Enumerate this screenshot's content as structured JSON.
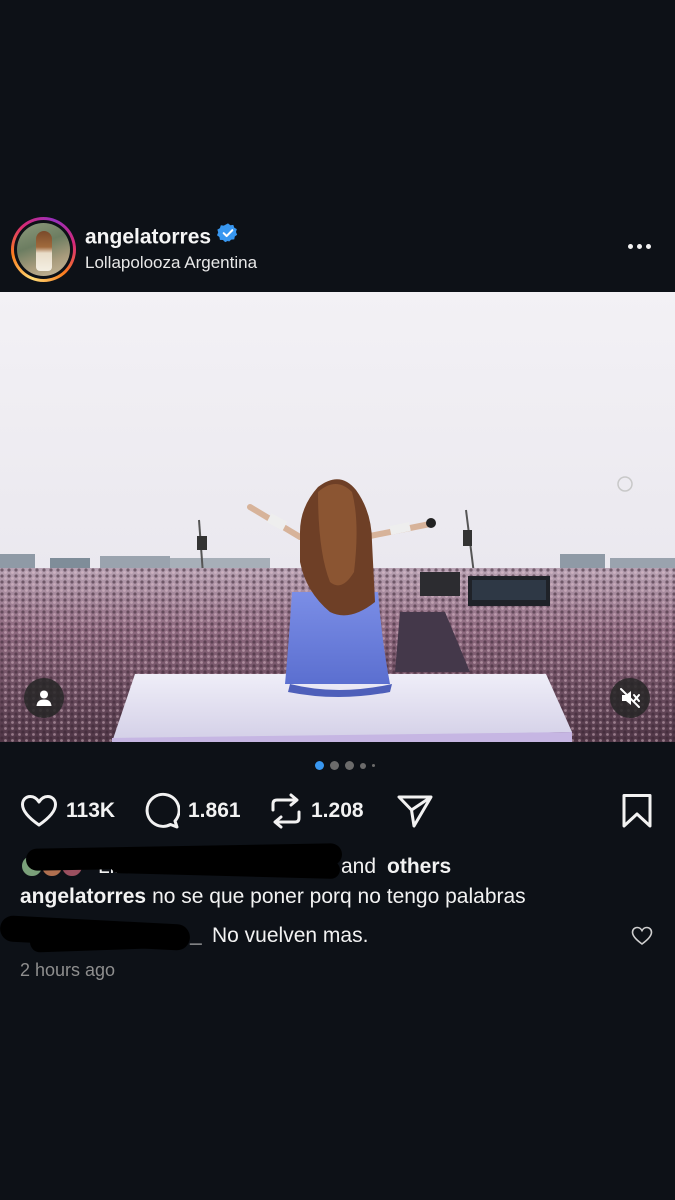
{
  "post": {
    "username": "angelatorres",
    "location": "Lollapolooza Argentina",
    "verified": true
  },
  "carousel": {
    "total_slides": 5,
    "active_index": 0
  },
  "actions": {
    "likes_count": "113K",
    "comments_count": "1.861",
    "reposts_count": "1.208"
  },
  "likes": {
    "visible_fragment": "Lik",
    "suffix_connector": "and",
    "suffix_others": "others"
  },
  "caption": {
    "author": "angelatorres",
    "text": "no se que poner porq no tengo palabras"
  },
  "comment": {
    "author_visible_fragment": "_",
    "text": "No vuelven mas."
  },
  "timestamp": "2 hours ago",
  "colors": {
    "background": "#0d1117",
    "accent_blue": "#3897f0",
    "active_dot": "#3897f0",
    "muted_text": "#8e8e8e"
  },
  "icons": {
    "header": [
      "verified-badge-icon",
      "more-options-icon"
    ],
    "photo": [
      "user-tag-icon",
      "mute-icon"
    ],
    "actions": [
      "heart-icon",
      "comment-icon",
      "repost-icon",
      "share-icon",
      "bookmark-icon"
    ],
    "comment": [
      "comment-like-icon"
    ]
  }
}
